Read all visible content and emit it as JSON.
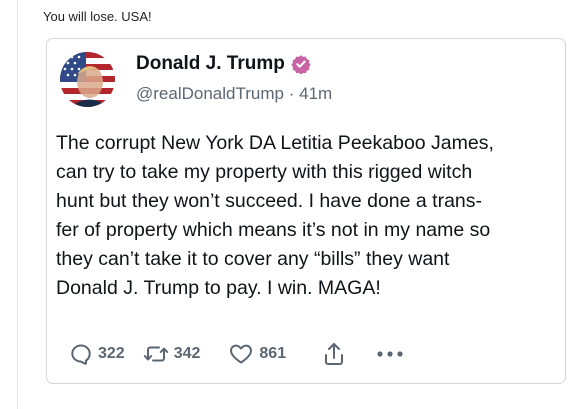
{
  "caption": "You will lose. USA!",
  "tweet": {
    "author_name": "Donald J. Trump",
    "handle": "@realDonaldTrump",
    "separator": "·",
    "time": "41m",
    "verified_color": "#c964a4",
    "text": "The corrupt New York DA Letitia Peekaboo James, can try to take my property with this rigged witch hunt but they won’t succeed. I have done a transfer of property which means it’s not in my name so they can’t take it to cover any “bills” they want Donald J. Trump to pay. I win. MAGA!",
    "text_lines": [
      "The corrupt New York DA Letitia Peekaboo James,",
      "can try to take my property with this rigged witch",
      "hunt but they won’t succeed. I have done a trans-",
      "fer of property which means it’s not in my name so",
      "they can’t take it to cover any “bills” they want",
      "Donald J. Trump to pay. I win. MAGA!"
    ],
    "actions": {
      "replies": "322",
      "retweets": "342",
      "likes": "861",
      "reply_icon": "reply-icon",
      "retweet_icon": "retweet-icon",
      "like_icon": "heart-icon",
      "share_icon": "share-icon",
      "more_icon": "more-icon"
    }
  }
}
